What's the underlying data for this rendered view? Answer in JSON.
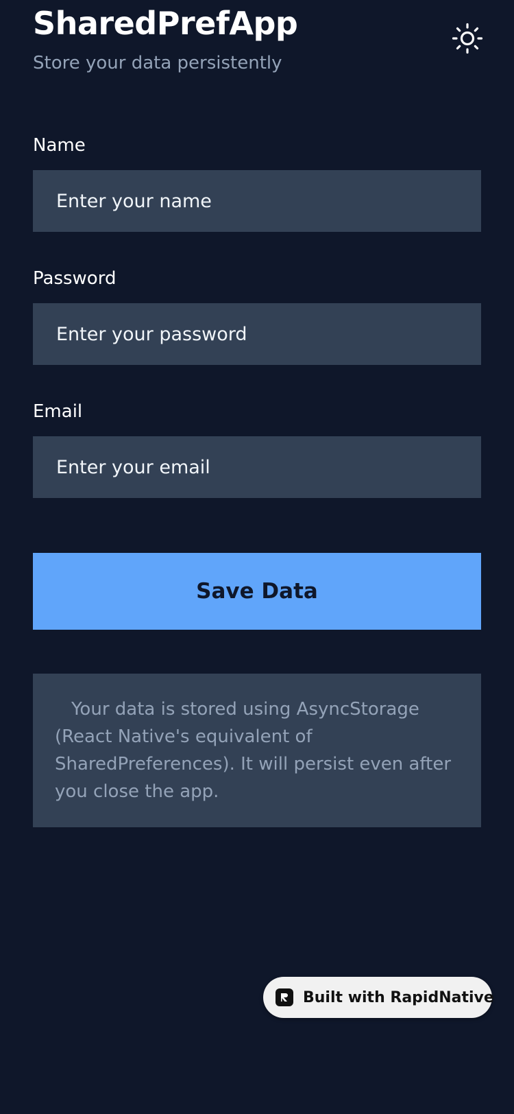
{
  "header": {
    "title": "SharedPrefApp",
    "subtitle": "Store your data persistently",
    "theme_icon": "sun-icon"
  },
  "form": {
    "name": {
      "label": "Name",
      "placeholder": "Enter your name",
      "value": ""
    },
    "password": {
      "label": "Password",
      "placeholder": "Enter your password",
      "value": ""
    },
    "email": {
      "label": "Email",
      "placeholder": "Enter your email",
      "value": ""
    },
    "save_label": "Save Data"
  },
  "info": {
    "text": "Your data is stored using AsyncStorage (React Native's equivalent of SharedPreferences). It will persist even after you close the app."
  },
  "badge": {
    "label": "Built with RapidNative",
    "icon": "rapidnative-logo-icon"
  },
  "colors": {
    "background": "#0f172a",
    "input_background": "#334155",
    "accent": "#60a5fa",
    "muted_text": "#94a3b8"
  }
}
